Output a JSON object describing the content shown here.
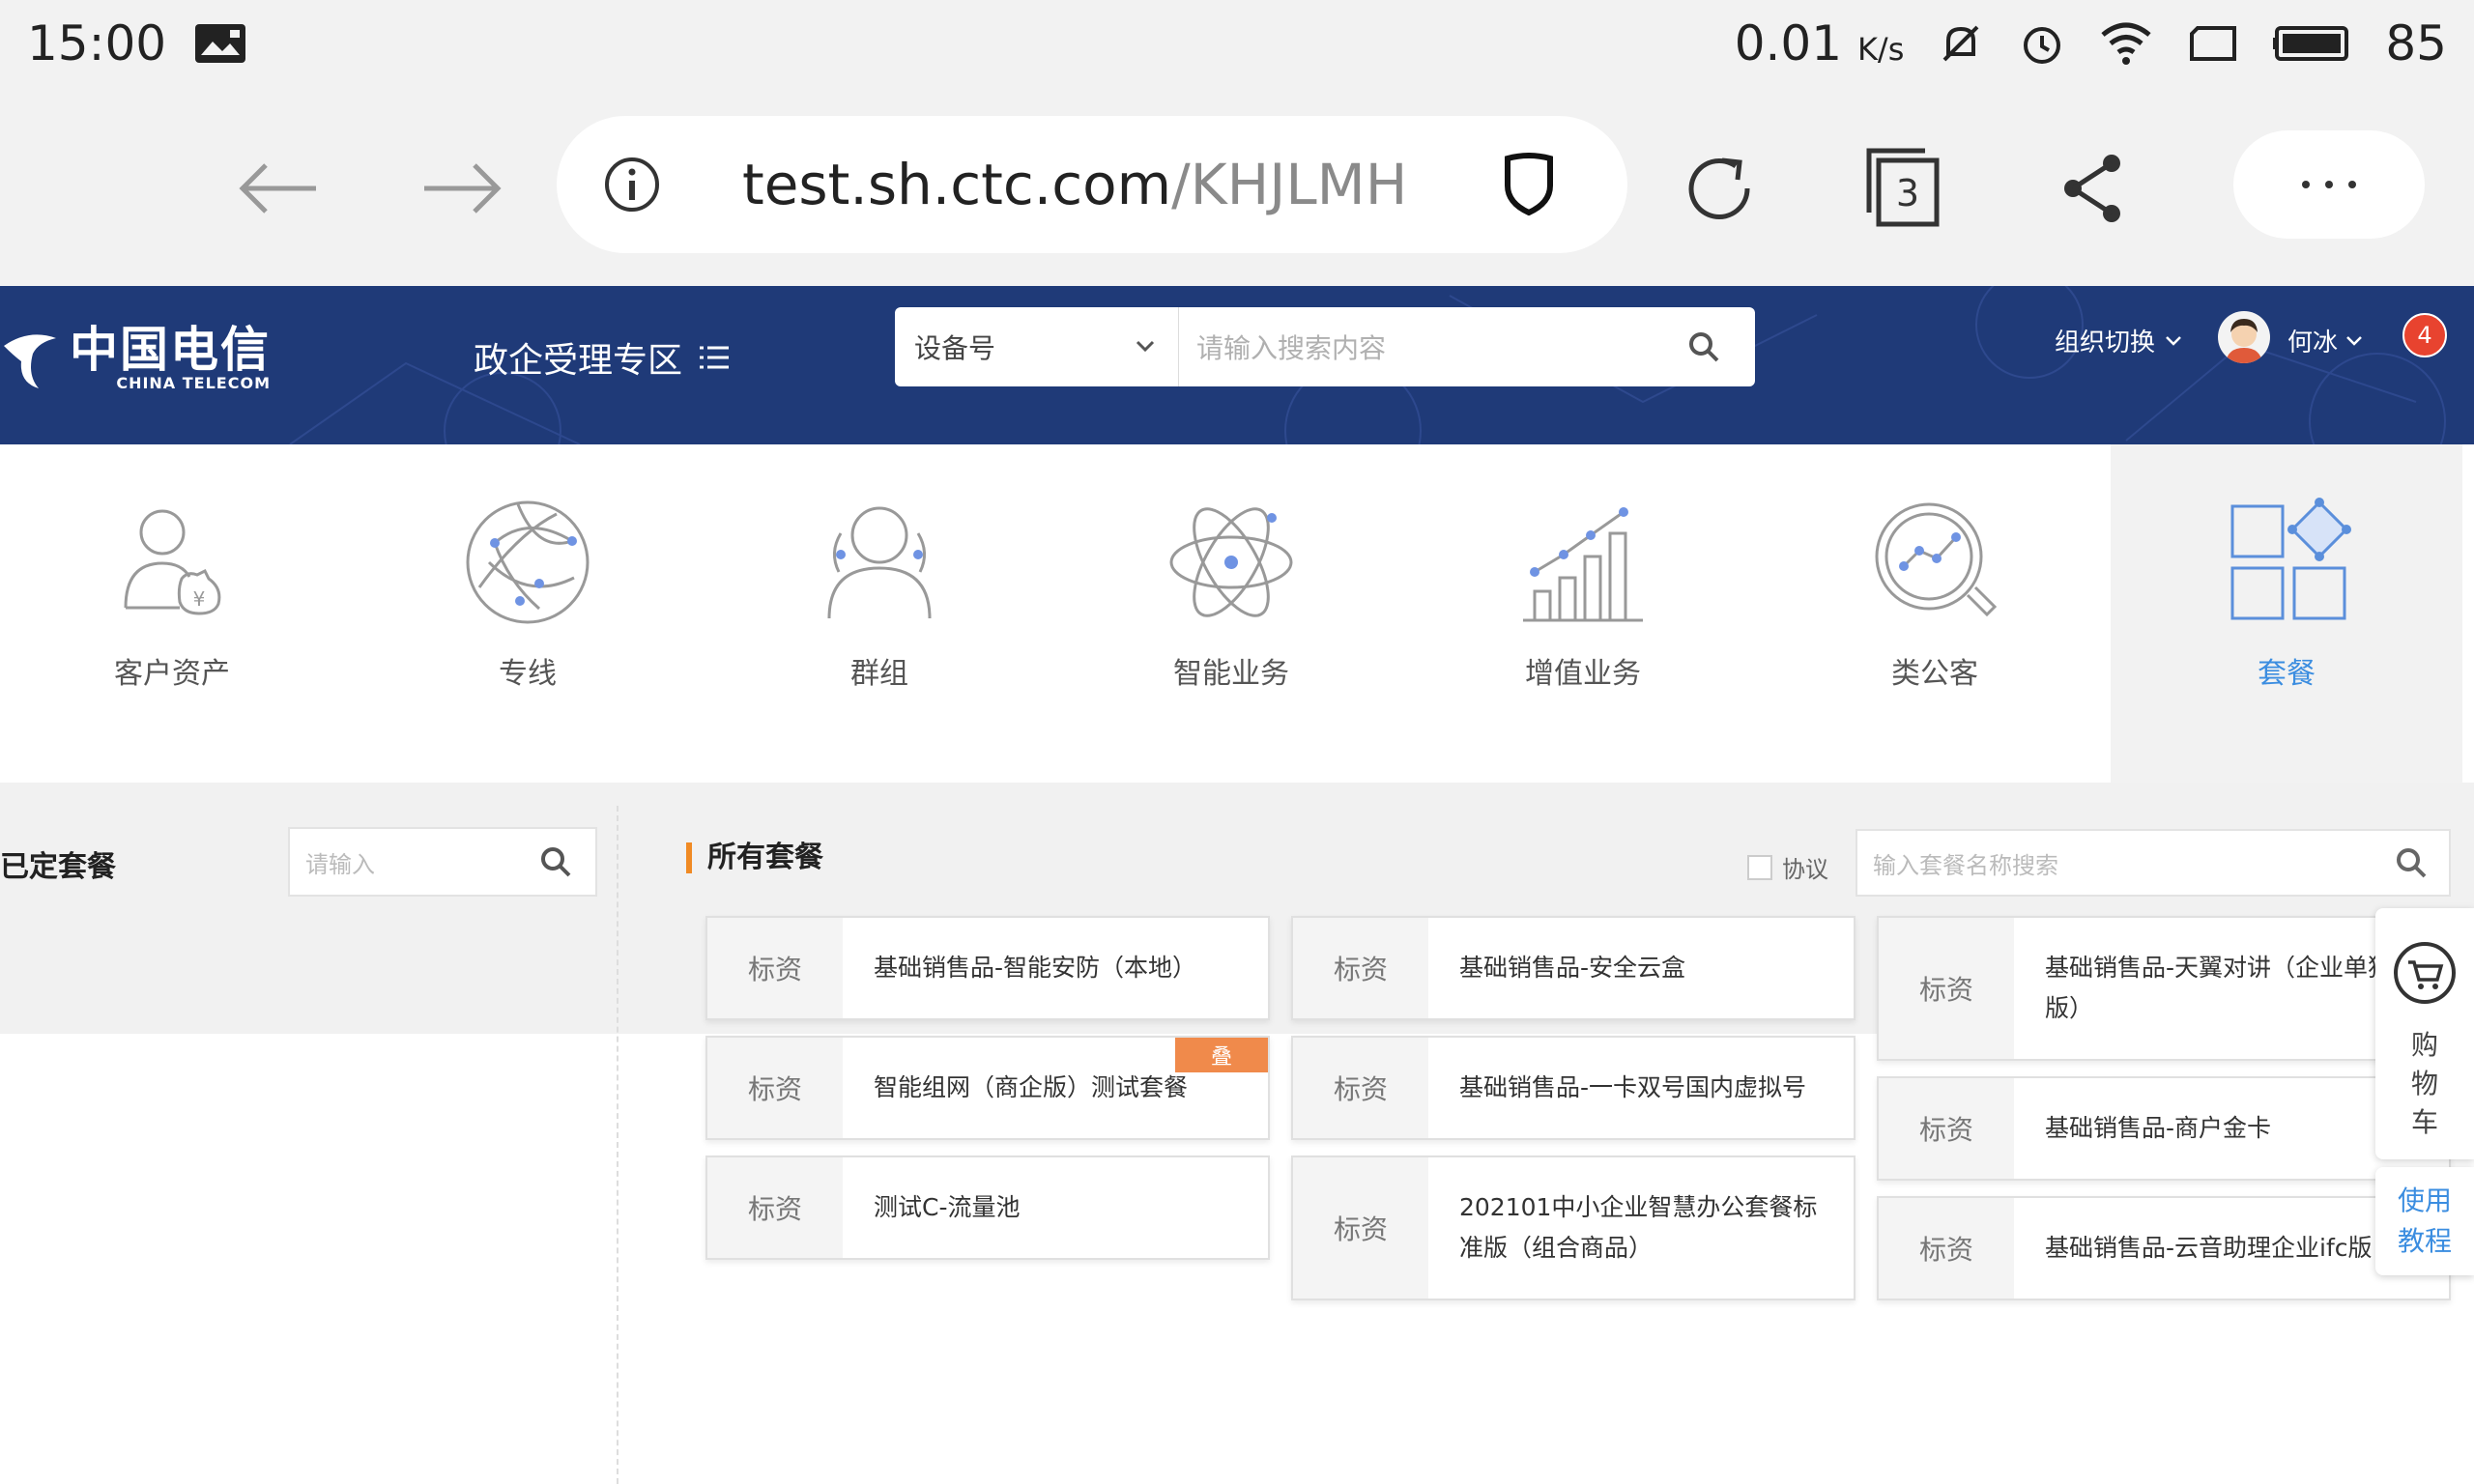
{
  "status_bar": {
    "time": "15:00",
    "speed": "0.01",
    "speed_unit": "K/s",
    "battery": "85"
  },
  "browser": {
    "url_host": "test.sh.ctc.com",
    "url_path": "/KHJLMH",
    "tab_count": "3"
  },
  "header": {
    "logo_cn": "中国电信",
    "logo_en": "CHINA TELECOM",
    "zone_title": "政企受理专区",
    "search_select": "设备号",
    "search_placeholder": "请输入搜索内容",
    "org_switch": "组织切换",
    "user_name": "何冰",
    "notification_count": "4"
  },
  "categories": [
    {
      "label": "客户资产"
    },
    {
      "label": "专线"
    },
    {
      "label": "群组"
    },
    {
      "label": "智能业务"
    },
    {
      "label": "增值业务"
    },
    {
      "label": "类公客"
    },
    {
      "label": "套餐"
    }
  ],
  "left_panel": {
    "title": "已定套餐",
    "search_placeholder": "请输入"
  },
  "right_panel": {
    "title": "所有套餐",
    "agreement_label": "协议",
    "search_placeholder": "输入套餐名称搜索"
  },
  "packages": [
    {
      "tag": "标资",
      "name": "基础销售品-智能安防（本地）"
    },
    {
      "tag": "标资",
      "name": "智能组网（商企版）测试套餐",
      "flag": "叠"
    },
    {
      "tag": "标资",
      "name": "测试C-流量池"
    },
    {
      "tag": "标资",
      "name": "基础销售品-安全云盒"
    },
    {
      "tag": "标资",
      "name": "基础销售品-一卡双号国内虚拟号"
    },
    {
      "tag": "标资",
      "name": "202101中小企业智慧办公套餐标准版（组合商品）"
    },
    {
      "tag": "标资",
      "name": "基础销售品-天翼对讲（企业单独购版）"
    },
    {
      "tag": "标资",
      "name": "基础销售品-商户金卡"
    },
    {
      "tag": "标资",
      "name": "基础销售品-云音助理企业ifc版"
    }
  ],
  "side": {
    "cart_label": "购物车",
    "help_label": "使用教程"
  },
  "colors": {
    "header_bg": "#1f3a78",
    "accent_blue": "#3b8de0",
    "accent_orange": "#f08a24",
    "badge_red": "#e8432f"
  }
}
